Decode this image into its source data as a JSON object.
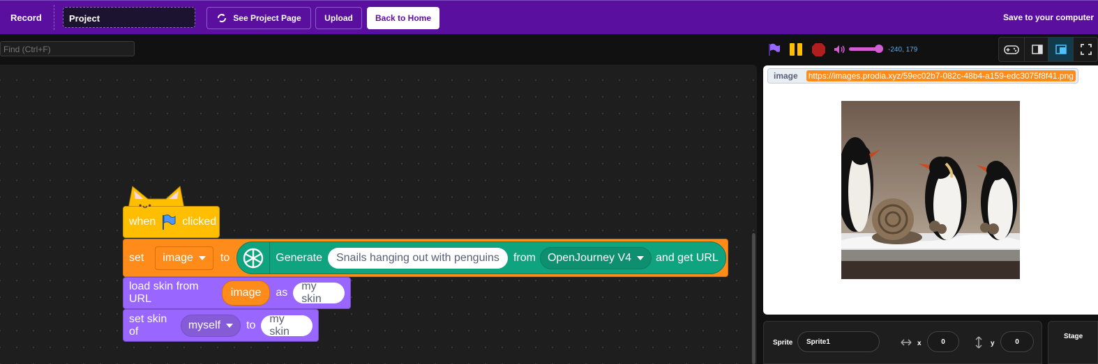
{
  "topbar": {
    "record_label": "Record",
    "project_title": "Project",
    "see_project_label": "See Project Page",
    "upload_label": "Upload",
    "back_home_label": "Back to Home",
    "save_label": "Save to your computer"
  },
  "find": {
    "placeholder": "Find (Ctrl+F)"
  },
  "blocks": {
    "hat": {
      "when": "when",
      "clicked": "clicked"
    },
    "set": {
      "keyword": "set",
      "variable": "image",
      "to": "to",
      "ai": {
        "generate": "Generate",
        "prompt": "Snails hanging out with penguins",
        "from": "from",
        "model": "OpenJourney V4",
        "tail": "and get URL"
      }
    },
    "load": {
      "prefix": "load skin from URL",
      "var": "image",
      "as": "as",
      "name": "my skin"
    },
    "skin": {
      "prefix": "set skin of",
      "target": "myself",
      "to": "to",
      "name": "my skin"
    }
  },
  "stage": {
    "coords": "-240, 179",
    "monitor_label": "image",
    "monitor_value": "https://images.prodia.xyz/59ec02b7-082c-48b4-a159-edc3075f8f41.png",
    "volume": 0.85
  },
  "sprite_panel": {
    "sprite_label": "Sprite",
    "sprite_name": "Sprite1",
    "x_label": "x",
    "x_value": "0",
    "y_label": "y",
    "y_value": "0"
  },
  "stage_panel": {
    "label": "Stage"
  },
  "colors": {
    "topbar": "#5a0f9e",
    "events": "#ffbf00",
    "variables": "#ff8c1a",
    "looks": "#9966ff",
    "openai": "#10a37f"
  }
}
